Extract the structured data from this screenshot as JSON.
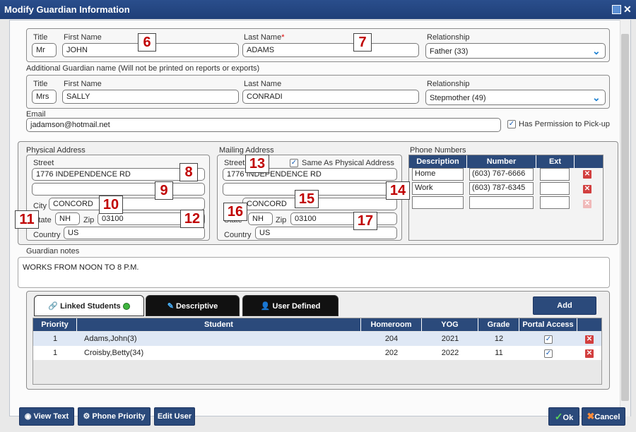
{
  "window": {
    "title": "Modify Guardian Information"
  },
  "guardian": {
    "title_label": "Title",
    "title_value": "Mr",
    "first_name_label": "First Name",
    "first_name_value": "JOHN",
    "last_name_label": "Last Name",
    "last_name_required": "*",
    "last_name_value": "ADAMS",
    "relationship_label": "Relationship",
    "relationship_value": "Father (33)"
  },
  "additional": {
    "section_label": "Additional Guardian name (Will not be printed on reports or exports)",
    "title_label": "Title",
    "title_value": "Mrs",
    "first_name_label": "First Name",
    "first_name_value": "SALLY",
    "last_name_label": "Last Name",
    "last_name_value": "CONRADI",
    "relationship_label": "Relationship",
    "relationship_value": "Stepmother (49)"
  },
  "email": {
    "label": "Email",
    "value": "jadamson@hotmail.net",
    "pickup_label": "Has Permission to Pick-up",
    "pickup_checked": true
  },
  "physical": {
    "heading": "Physical Address",
    "street_label": "Street",
    "street1": "1776 INDEPENDENCE RD",
    "street2": "",
    "city_label": "City",
    "city": "CONCORD",
    "state_label": "State",
    "state": "NH",
    "zip_label": "Zip",
    "zip": "03100",
    "country_label": "Country",
    "country": "US"
  },
  "mailing": {
    "heading": "Mailing Address",
    "street_label": "Street",
    "same_label": "Same As Physical Address",
    "same_checked": true,
    "street1": "1776 INDEPENDENCE RD",
    "street2": "",
    "city": "CONCORD",
    "state_label": "State",
    "state": "NH",
    "zip_label": "Zip",
    "zip": "03100",
    "country_label": "Country",
    "country": "US"
  },
  "phones": {
    "heading": "Phone Numbers",
    "columns": [
      "Description",
      "Number",
      "Ext"
    ],
    "rows": [
      {
        "description": "Home",
        "number": "(603) 767-6666",
        "ext": ""
      },
      {
        "description": "Work",
        "number": "(603) 787-6345",
        "ext": ""
      },
      {
        "description": "",
        "number": "",
        "ext": ""
      }
    ]
  },
  "notes": {
    "label": "Guardian notes",
    "value": "WORKS FROM NOON TO 8 P.M."
  },
  "callouts": [
    "6",
    "7",
    "8",
    "9",
    "10",
    "11",
    "12",
    "13",
    "14",
    "15",
    "16",
    "17"
  ],
  "tabs": {
    "linked": "Linked Students",
    "descriptive": "Descriptive",
    "user_defined": "User Defined",
    "add": "Add"
  },
  "students": {
    "columns": [
      "Priority",
      "Student",
      "Homeroom",
      "YOG",
      "Grade",
      "Portal Access"
    ],
    "rows": [
      {
        "priority": "1",
        "student": "Adams,John(3)",
        "homeroom": "204",
        "yog": "2021",
        "grade": "12",
        "portal": true
      },
      {
        "priority": "1",
        "student": "Croisby,Betty(34)",
        "homeroom": "202",
        "yog": "2022",
        "grade": "11",
        "portal": true
      }
    ]
  },
  "footer": {
    "view_text": "View Text",
    "phone_priority": "Phone Priority",
    "edit_user": "Edit User",
    "ok": "Ok",
    "cancel": "Cancel"
  },
  "colors": {
    "header_blue": "#2b4a7b",
    "title_blue": "#2a4e8c",
    "callout_red": "#c00000",
    "delete_red": "#d23f3f"
  }
}
